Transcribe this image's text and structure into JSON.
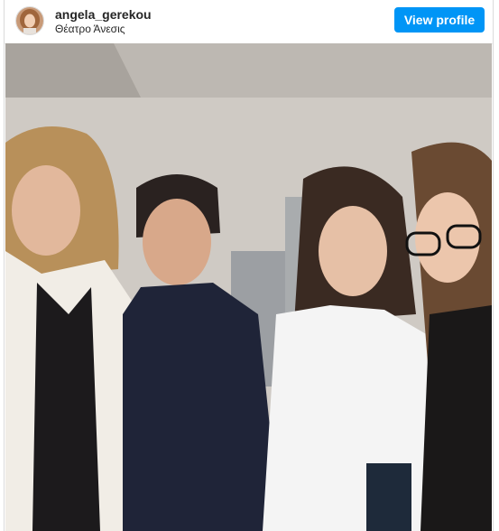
{
  "post": {
    "username": "angela_gerekou",
    "location": "Θέατρο Άνεσις",
    "view_profile_label": "View profile"
  },
  "colors": {
    "accent": "#0095f6",
    "text": "#262626",
    "border": "#dbdbdb"
  },
  "icons": {
    "avatar": "profile-avatar-image"
  }
}
